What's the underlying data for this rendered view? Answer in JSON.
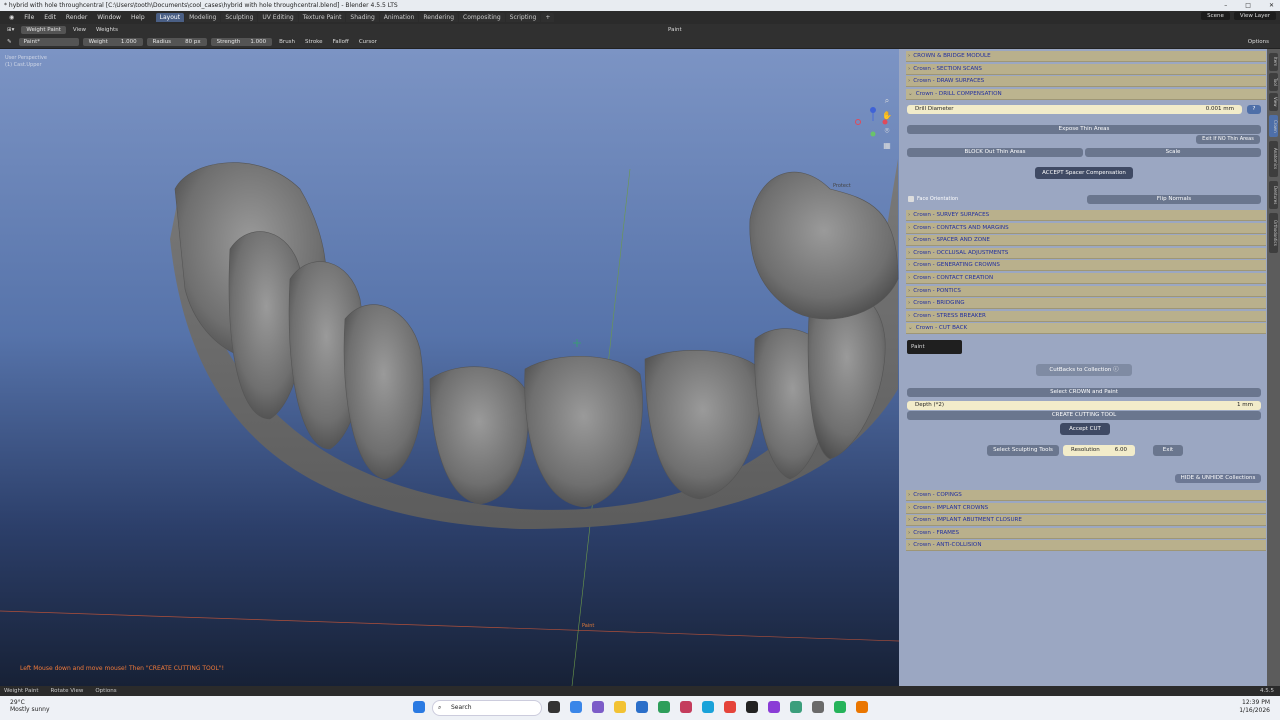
{
  "window": {
    "title": "* hybrid with hole throughcentral [C:\\Users\\tooth\\Documents\\cool_cases\\hybrid with hole throughcentral.blend] - Blender 4.5.5 LTS"
  },
  "menu": [
    "File",
    "Edit",
    "Render",
    "Window",
    "Help"
  ],
  "workspaces": [
    "Layout",
    "Modeling",
    "Sculpting",
    "UV Editing",
    "Texture Paint",
    "Shading",
    "Animation",
    "Rendering",
    "Compositing",
    "Scripting"
  ],
  "scene": "Scene",
  "view_layer": "View Layer",
  "toolbar1": {
    "mode": "Weight Paint",
    "view": "View",
    "weights": "Weights",
    "shading": "Paint"
  },
  "toolbar2": {
    "brush": "Paint*",
    "weight_label": "Weight",
    "weight_value": "1.000",
    "radius_label": "Radius",
    "radius_value": "80 px",
    "strength_label": "Strength",
    "strength_value": "1.000",
    "brush_menu": "Brush",
    "stroke_menu": "Stroke",
    "falloff_menu": "Falloff",
    "cursor_menu": "Cursor",
    "options": "Options"
  },
  "viewport": {
    "info_line1": "User Perspective",
    "info_line2": "(1) Cast.Upper",
    "hint": "Left Mouse down and move mouse! Then \"CREATE CUTTING TOOL\"!",
    "origin_label": "Paint",
    "protect_label": "Protect"
  },
  "panel": {
    "top_sections": [
      "CROWN & BRIDGE MODULE",
      "Crown -  SECTION SCANS",
      "Crown -  DRAW SURFACES",
      "Crown -  DRILL COMPENSATION"
    ],
    "drill_label": "Drill Diameter",
    "drill_value": "0.001 mm",
    "expose_thin": "Expose Thin Areas",
    "exit_no_thin": "Exit If NO Thin Areas",
    "block_out": "BLOCK Out Thin Areas",
    "scale": "Scale",
    "accept_spacer": "ACCEPT Spacer Compensation",
    "face_orientation": "Face Orientation",
    "flip_normals": "Flip Normals",
    "mid_sections": [
      "Crown -  SURVEY SURFACES",
      "Crown -  CONTACTS AND MARGINS",
      "Crown -  SPACER AND ZONE",
      "Crown -  OCCLUSAL ADJUSTMENTS",
      "Crown -  GENERATING CROWNS",
      "Crown -  CONTACT CREATION",
      "Crown -  PONTICS",
      "Crown -  BRIDGING",
      "Crown -  STRESS BREAKER",
      "Crown -  CUT BACK"
    ],
    "paint_field": "Paint",
    "cutbacks_collection": "CutBacks to Collection",
    "select_crown_paint": "Select CROWN and Paint",
    "depth_label": "Depth (*2)",
    "depth_value": "1 mm",
    "create_cutting_tool": "CREATE CUTTING TOOL",
    "accept_cut": "Accept CUT",
    "select_sculpting": "Select Sculpting Tools",
    "resolution_label": "Resolution",
    "resolution_value": "6.00",
    "exit": "Exit",
    "hide_unhide": "HIDE & UNHIDE Collections",
    "bottom_sections": [
      "Crown -  COPINGS",
      "Crown -  IMPLANT CROWNS",
      "Crown -  IMPLANT  ABUTMENT CLOSURE",
      "Crown -  FRAMES",
      "Crown -  ANTI-COLLISION"
    ]
  },
  "sidebar_tabs": [
    "Item",
    "Tool",
    "View",
    "Crown",
    "Anatomics",
    "Dentures",
    "Orthodontics"
  ],
  "statusbar": {
    "weight_paint": "Weight Paint",
    "rotate": "Rotate View",
    "options": "Options",
    "version": "4.5.5"
  },
  "taskbar": {
    "temp": "29°C",
    "weather": "Mostly sunny",
    "search": "Search",
    "time": "12:39 PM",
    "date": "1/16/2026"
  },
  "colors": {
    "panel_header": "#b9b08c",
    "panel_text": "#2230a0",
    "hint": "#f07a3a",
    "sidebar_bg": "#9ba7c2",
    "active_tab": "#4a5f85"
  }
}
